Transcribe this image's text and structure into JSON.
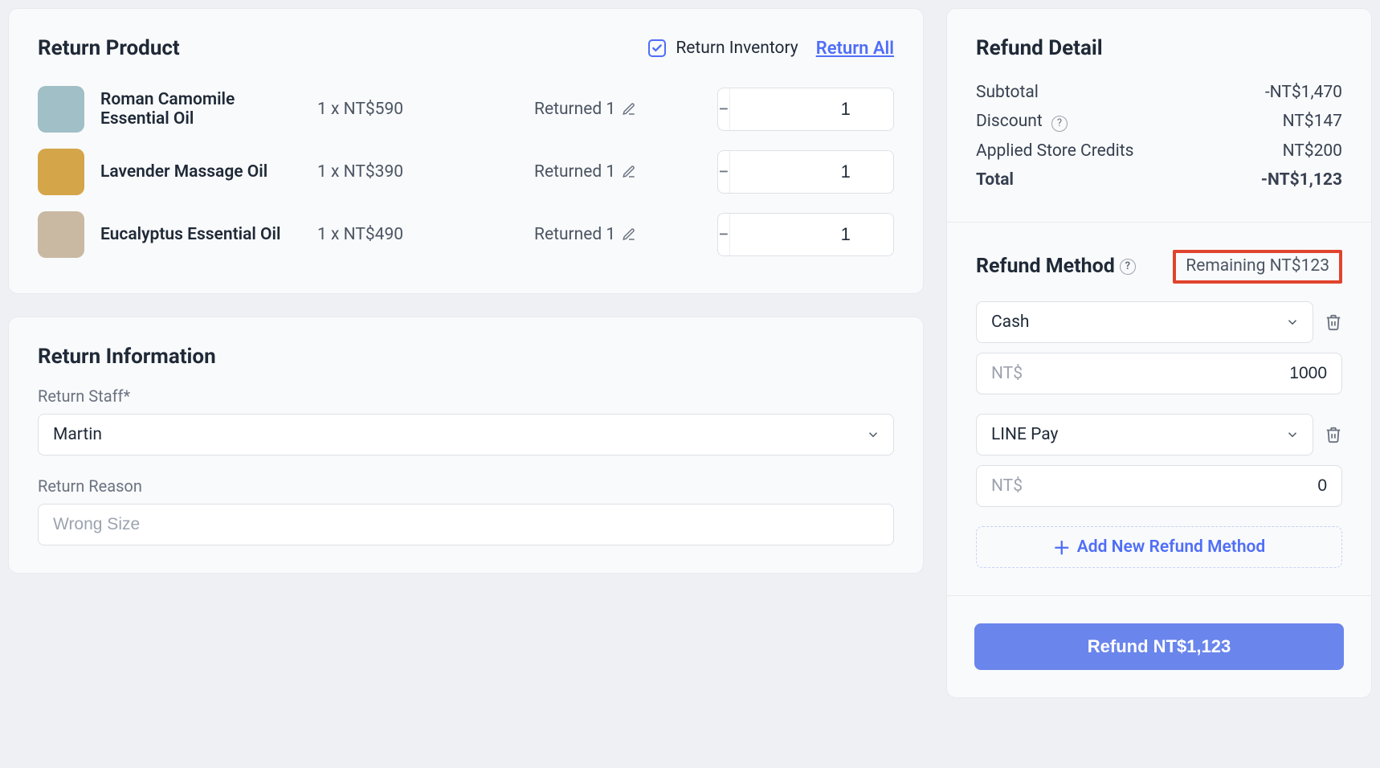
{
  "return_product": {
    "title": "Return Product",
    "return_inventory_label": "Return Inventory",
    "return_all_label": "Return All",
    "items": [
      {
        "name": "Roman Camomile Essential Oil",
        "price_line": "1 x NT$590",
        "returned_text": "Returned 1",
        "qty": "1",
        "thumb_color": "#a0bfc6"
      },
      {
        "name": "Lavender Massage Oil",
        "price_line": "1 x NT$390",
        "returned_text": "Returned 1",
        "qty": "1",
        "thumb_color": "#d5a54a"
      },
      {
        "name": "Eucalyptus Essential Oil",
        "price_line": "1 x NT$490",
        "returned_text": "Returned 1",
        "qty": "1",
        "thumb_color": "#c9b9a2"
      }
    ]
  },
  "return_info": {
    "title": "Return Information",
    "staff_label": "Return Staff*",
    "staff_value": "Martin",
    "reason_label": "Return Reason",
    "reason_placeholder": "Wrong Size"
  },
  "refund_detail": {
    "title": "Refund Detail",
    "rows": {
      "subtotal_label": "Subtotal",
      "subtotal_value": "-NT$1,470",
      "discount_label": "Discount",
      "discount_value": "NT$147",
      "credits_label": "Applied Store Credits",
      "credits_value": "NT$200",
      "total_label": "Total",
      "total_value": "-NT$1,123"
    }
  },
  "refund_method": {
    "title": "Refund Method",
    "remaining_text": "Remaining NT$123",
    "currency_prefix": "NT$",
    "methods": [
      {
        "name": "Cash",
        "amount": "1000"
      },
      {
        "name": "LINE Pay",
        "amount": "0"
      }
    ],
    "add_label": "Add New Refund Method"
  },
  "action": {
    "refund_button": "Refund NT$1,123"
  }
}
